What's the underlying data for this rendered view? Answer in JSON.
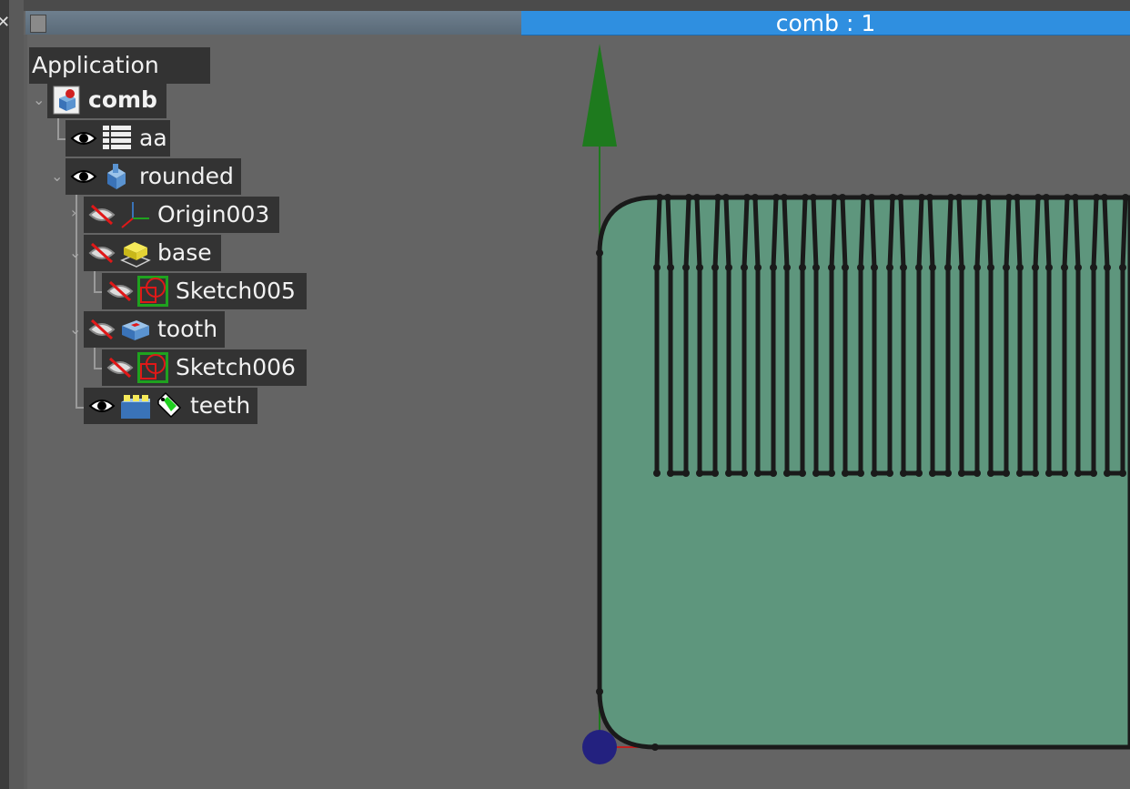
{
  "window": {
    "title": "comb : 1"
  },
  "tree": {
    "header": "Application",
    "root": "comb",
    "items": [
      {
        "label": "aa",
        "visibility": "visible",
        "icon": "spreadsheet-icon"
      },
      {
        "label": "rounded",
        "visibility": "visible",
        "icon": "body-icon"
      },
      {
        "label": "Origin003",
        "visibility": "hidden",
        "icon": "origin-icon"
      },
      {
        "label": "base",
        "visibility": "hidden",
        "icon": "pad-icon"
      },
      {
        "label": "Sketch005",
        "visibility": "hidden",
        "icon": "sketch-icon"
      },
      {
        "label": "tooth",
        "visibility": "hidden",
        "icon": "pocket-icon"
      },
      {
        "label": "Sketch006",
        "visibility": "hidden",
        "icon": "sketch-icon"
      },
      {
        "label": "teeth",
        "visibility": "visible",
        "icon": "pattern-icon"
      }
    ]
  },
  "colors": {
    "accent": "#2f8fe0",
    "shape_fill": "#5e967d",
    "axis_green": "#1e7a1e",
    "origin_blue": "#23217f"
  }
}
